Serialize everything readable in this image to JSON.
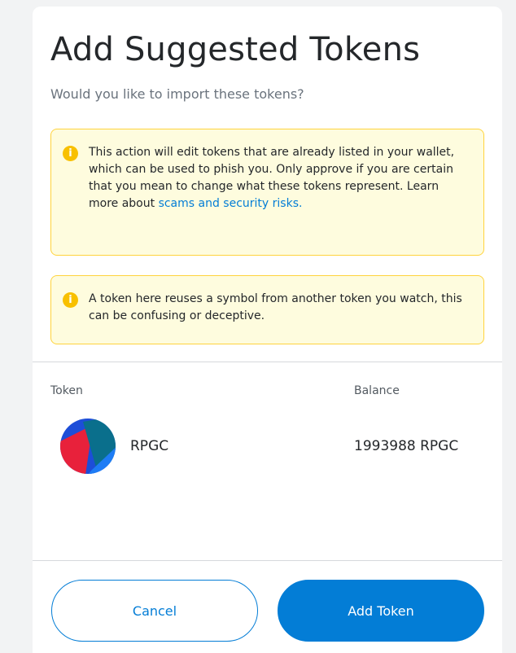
{
  "header": {
    "title": "Add Suggested Tokens",
    "subtitle": "Would you like to import these tokens?"
  },
  "warnings": [
    {
      "icon": "info-icon",
      "icon_glyph": "i",
      "text_before": "This action will edit tokens that are already listed in your wallet, which can be used to phish you. Only approve if you are certain that you mean to change what these tokens represent. Learn more about ",
      "link_text": "scams and security risks."
    },
    {
      "icon": "info-icon",
      "icon_glyph": "i",
      "text": "A token here reuses a symbol from another token you watch, this can be confusing or deceptive."
    }
  ],
  "table": {
    "columns": [
      "Token",
      "Balance"
    ],
    "rows": [
      {
        "symbol": "RPGC",
        "balance": "1993988 RPGC",
        "avatar_colors": [
          "#1d4ed8",
          "#e8213b",
          "#0a6f8c",
          "#1e7cf5"
        ]
      }
    ]
  },
  "footer": {
    "cancel_label": "Cancel",
    "add_label": "Add Token"
  },
  "colors": {
    "accent": "#037dd6",
    "warning_bg": "#fefcde",
    "warning_border": "#ffd33d",
    "warning_icon": "#f8c000"
  }
}
